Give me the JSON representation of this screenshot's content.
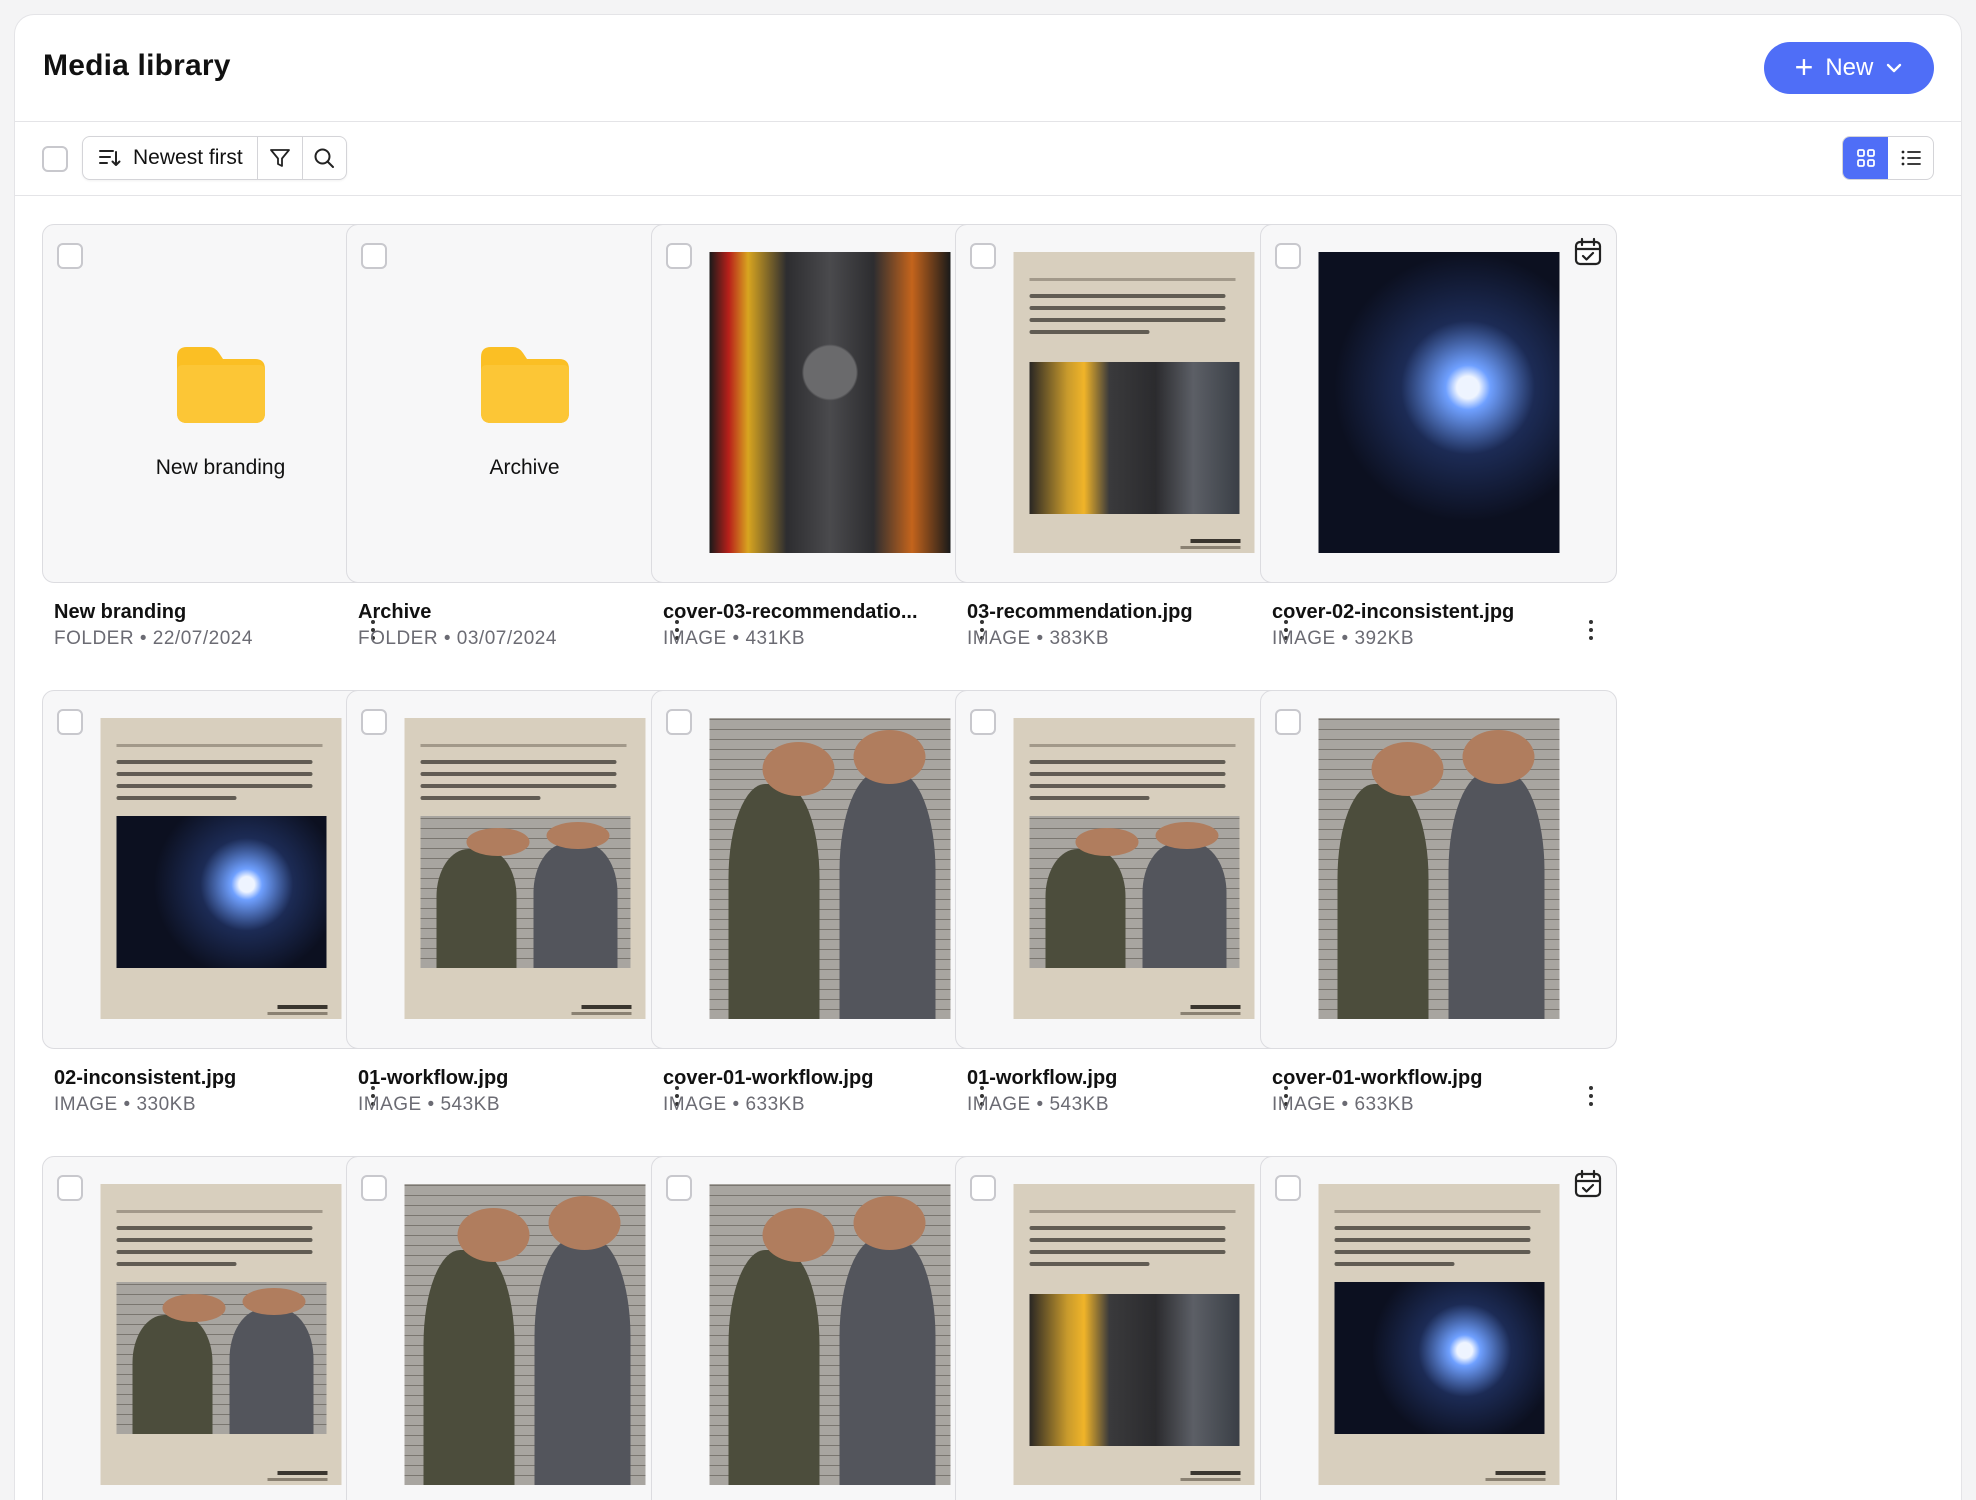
{
  "header": {
    "title": "Media library",
    "new_button_label": "New"
  },
  "toolbar": {
    "sort_label": "Newest first"
  },
  "items": [
    {
      "kind": "folder",
      "name": "New branding",
      "type": "FOLDER",
      "detail": "22/07/2024",
      "scheduled": false
    },
    {
      "kind": "folder",
      "name": "Archive",
      "type": "FOLDER",
      "detail": "03/07/2024",
      "scheduled": false
    },
    {
      "kind": "image",
      "style": "van-full",
      "name": "cover-03-recommendatio...",
      "type": "IMAGE",
      "detail": "431KB",
      "scheduled": true
    },
    {
      "kind": "image",
      "style": "poster-van",
      "name": "03-recommendation.jpg",
      "type": "IMAGE",
      "detail": "383KB",
      "scheduled": true
    },
    {
      "kind": "image",
      "style": "weld-full",
      "name": "cover-02-inconsistent.jpg",
      "type": "IMAGE",
      "detail": "392KB",
      "scheduled": true
    },
    {
      "kind": "image",
      "style": "poster-weld",
      "name": "02-inconsistent.jpg",
      "type": "IMAGE",
      "detail": "330KB",
      "scheduled": true
    },
    {
      "kind": "image",
      "style": "poster-brick",
      "name": "01-workflow.jpg",
      "type": "IMAGE",
      "detail": "543KB",
      "scheduled": true
    },
    {
      "kind": "image",
      "style": "brick-full",
      "name": "cover-01-workflow.jpg",
      "type": "IMAGE",
      "detail": "633KB",
      "scheduled": true
    },
    {
      "kind": "image",
      "style": "poster-brick",
      "name": "01-workflow.jpg",
      "type": "IMAGE",
      "detail": "543KB",
      "scheduled": false
    },
    {
      "kind": "image",
      "style": "brick-full",
      "name": "cover-01-workflow.jpg",
      "type": "IMAGE",
      "detail": "633KB",
      "scheduled": false
    },
    {
      "kind": "image",
      "style": "poster-brick",
      "name": "",
      "type": "",
      "detail": "",
      "scheduled": false
    },
    {
      "kind": "image",
      "style": "brick-full",
      "name": "",
      "type": "",
      "detail": "",
      "scheduled": false
    },
    {
      "kind": "image",
      "style": "brick-full",
      "name": "",
      "type": "",
      "detail": "",
      "scheduled": false
    },
    {
      "kind": "image",
      "style": "poster-van",
      "name": "",
      "type": "",
      "detail": "",
      "scheduled": true
    },
    {
      "kind": "image",
      "style": "poster-weld",
      "name": "",
      "type": "",
      "detail": "",
      "scheduled": true
    }
  ],
  "colors": {
    "accent": "#4f6ef7",
    "folder": "#fbbf24"
  }
}
